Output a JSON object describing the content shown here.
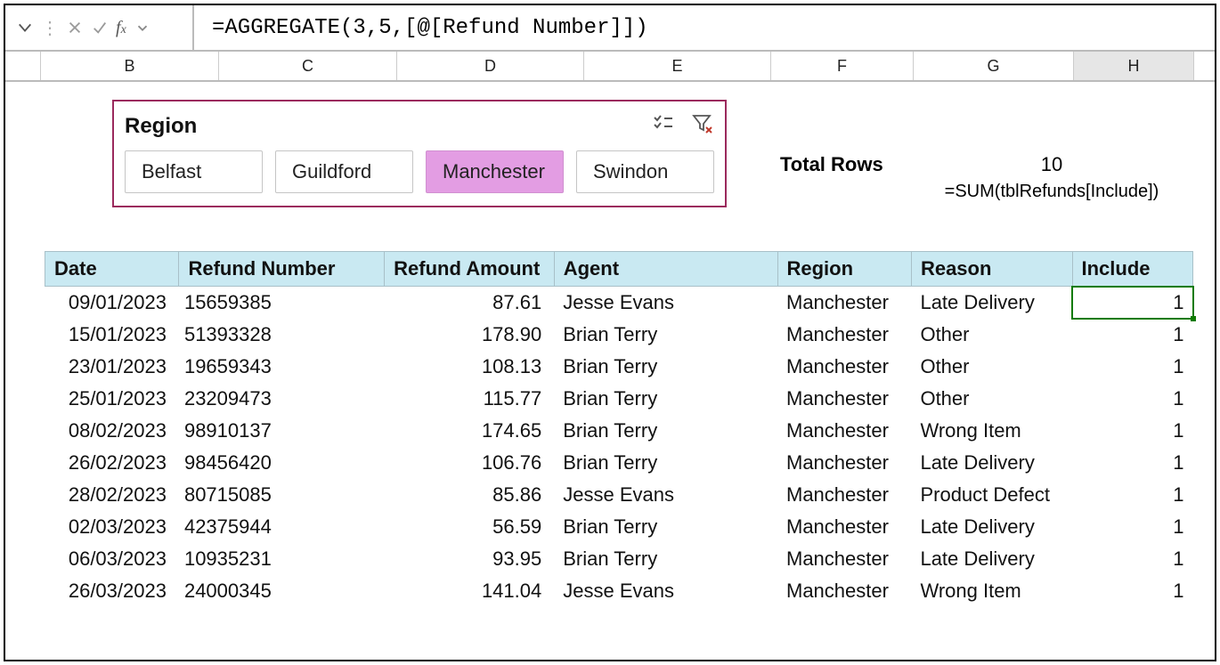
{
  "formula_bar": {
    "value": "=AGGREGATE(3,5,[@[Refund Number]])"
  },
  "columns": [
    "B",
    "C",
    "D",
    "E",
    "F",
    "G",
    "H"
  ],
  "selected_column": "H",
  "slicer": {
    "title": "Region",
    "items": [
      {
        "label": "Belfast",
        "active": false
      },
      {
        "label": "Guildford",
        "active": false
      },
      {
        "label": "Manchester",
        "active": true
      },
      {
        "label": "Swindon",
        "active": false
      }
    ]
  },
  "total_rows": {
    "label": "Total Rows",
    "value": "10",
    "formula": "=SUM(tblRefunds[Include])"
  },
  "table": {
    "headers": [
      "Date",
      "Refund Number",
      "Refund Amount",
      "Agent",
      "Region",
      "Reason",
      "Include"
    ],
    "rows": [
      {
        "date": "09/01/2023",
        "ref": "15659385",
        "amt": "87.61",
        "agent": "Jesse Evans",
        "region": "Manchester",
        "reason": "Late Delivery",
        "inc": "1"
      },
      {
        "date": "15/01/2023",
        "ref": "51393328",
        "amt": "178.90",
        "agent": "Brian Terry",
        "region": "Manchester",
        "reason": "Other",
        "inc": "1"
      },
      {
        "date": "23/01/2023",
        "ref": "19659343",
        "amt": "108.13",
        "agent": "Brian Terry",
        "region": "Manchester",
        "reason": "Other",
        "inc": "1"
      },
      {
        "date": "25/01/2023",
        "ref": "23209473",
        "amt": "115.77",
        "agent": "Brian Terry",
        "region": "Manchester",
        "reason": "Other",
        "inc": "1"
      },
      {
        "date": "08/02/2023",
        "ref": "98910137",
        "amt": "174.65",
        "agent": "Brian Terry",
        "region": "Manchester",
        "reason": "Wrong Item",
        "inc": "1"
      },
      {
        "date": "26/02/2023",
        "ref": "98456420",
        "amt": "106.76",
        "agent": "Brian Terry",
        "region": "Manchester",
        "reason": "Late Delivery",
        "inc": "1"
      },
      {
        "date": "28/02/2023",
        "ref": "80715085",
        "amt": "85.86",
        "agent": "Jesse Evans",
        "region": "Manchester",
        "reason": "Product Defect",
        "inc": "1"
      },
      {
        "date": "02/03/2023",
        "ref": "42375944",
        "amt": "56.59",
        "agent": "Brian Terry",
        "region": "Manchester",
        "reason": "Late Delivery",
        "inc": "1"
      },
      {
        "date": "06/03/2023",
        "ref": "10935231",
        "amt": "93.95",
        "agent": "Brian Terry",
        "region": "Manchester",
        "reason": "Late Delivery",
        "inc": "1"
      },
      {
        "date": "26/03/2023",
        "ref": "24000345",
        "amt": "141.04",
        "agent": "Jesse Evans",
        "region": "Manchester",
        "reason": "Wrong Item",
        "inc": "1"
      }
    ]
  }
}
